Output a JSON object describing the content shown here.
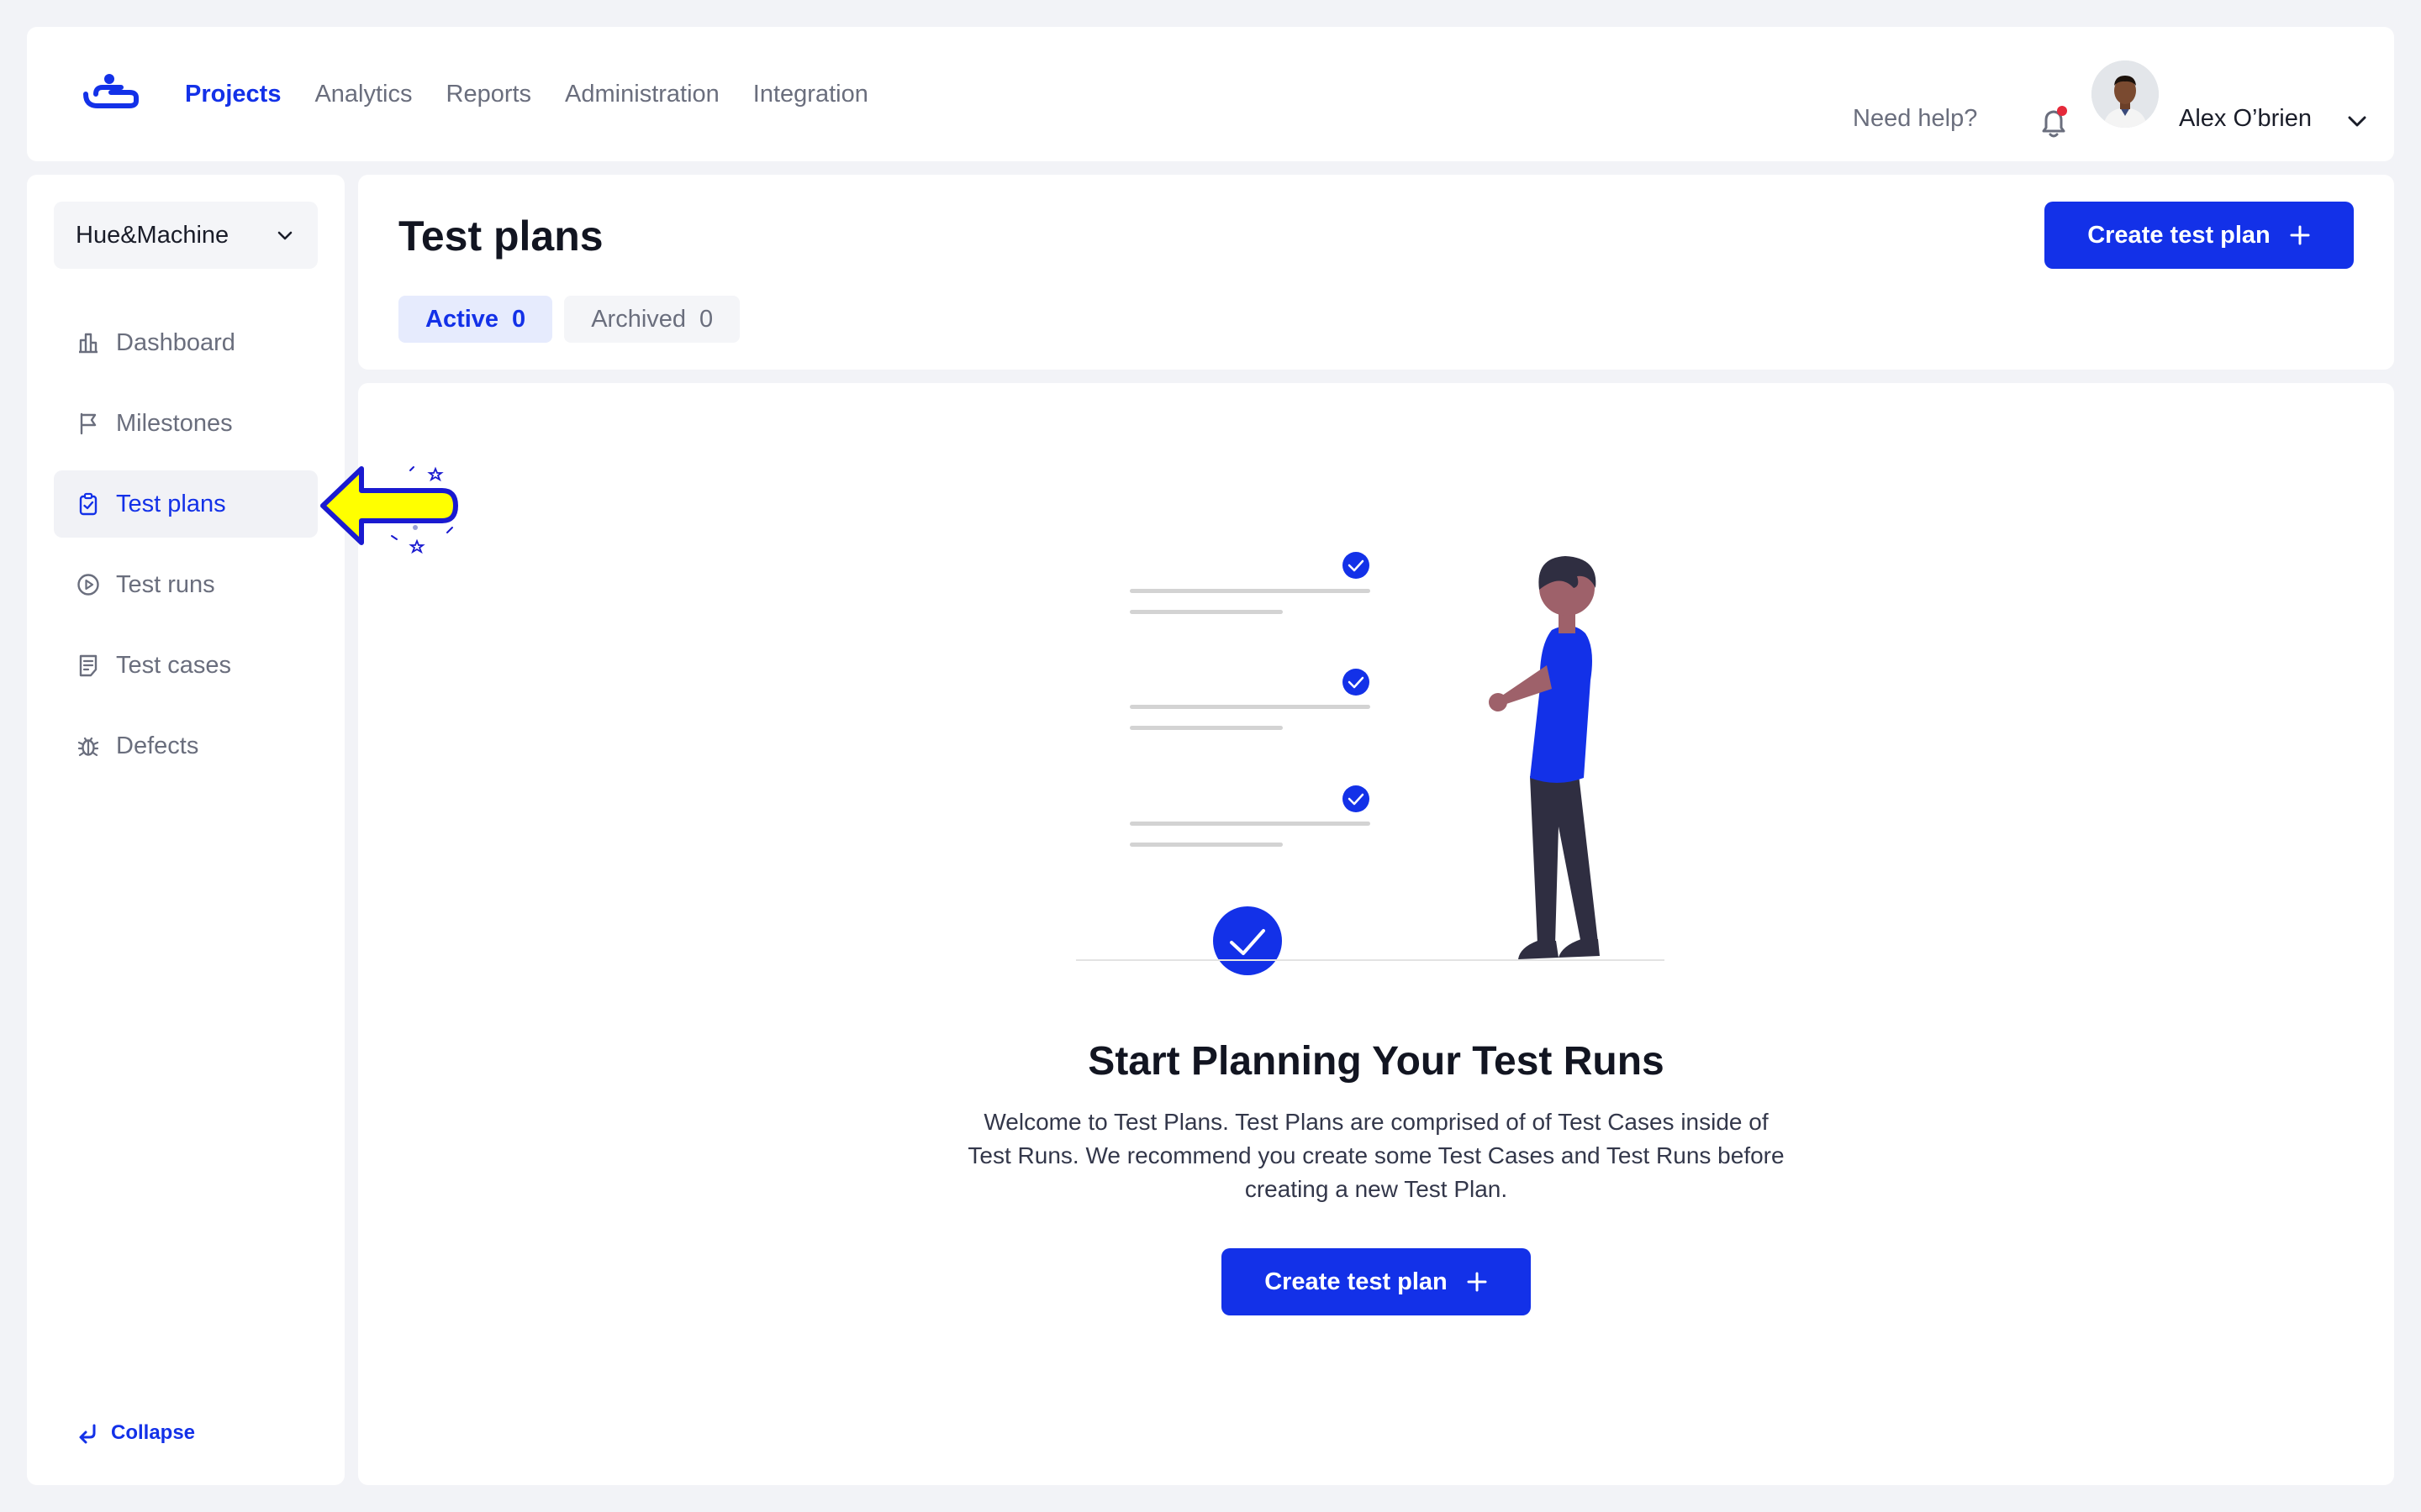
{
  "topbar": {
    "nav": [
      {
        "label": "Projects",
        "active": true
      },
      {
        "label": "Analytics",
        "active": false
      },
      {
        "label": "Reports",
        "active": false
      },
      {
        "label": "Administration",
        "active": false
      },
      {
        "label": "Integration",
        "active": false
      }
    ],
    "help_label": "Need help?",
    "user_name": "Alex O’brien",
    "notification_dot_color": "#e5293a"
  },
  "sidebar": {
    "project_name": "Hue&Machine",
    "items": [
      {
        "label": "Dashboard",
        "icon": "dashboard-icon",
        "active": false
      },
      {
        "label": "Milestones",
        "icon": "flag-icon",
        "active": false
      },
      {
        "label": "Test plans",
        "icon": "clipboard-check-icon",
        "active": true
      },
      {
        "label": "Test runs",
        "icon": "play-circle-icon",
        "active": false
      },
      {
        "label": "Test cases",
        "icon": "document-list-icon",
        "active": false
      },
      {
        "label": "Defects",
        "icon": "bug-icon",
        "active": false
      }
    ],
    "collapse_label": "Collapse"
  },
  "header": {
    "title": "Test plans",
    "create_button_label": "Create test plan",
    "tabs": [
      {
        "label": "Active",
        "count": "0",
        "active": true
      },
      {
        "label": "Archived",
        "count": "0",
        "active": false
      }
    ]
  },
  "empty_state": {
    "title": "Start Planning Your Test Runs",
    "description": "Welcome to Test Plans. Test Plans are comprised of  of Test Cases inside of Test Runs. We recommend you create some Test Cases and Test Runs before creating a new Test Plan.",
    "button_label": "Create test plan"
  },
  "colors": {
    "accent": "#1331e8",
    "page_background": "#f2f3f7",
    "annotation_arrow": "#ffff00"
  }
}
